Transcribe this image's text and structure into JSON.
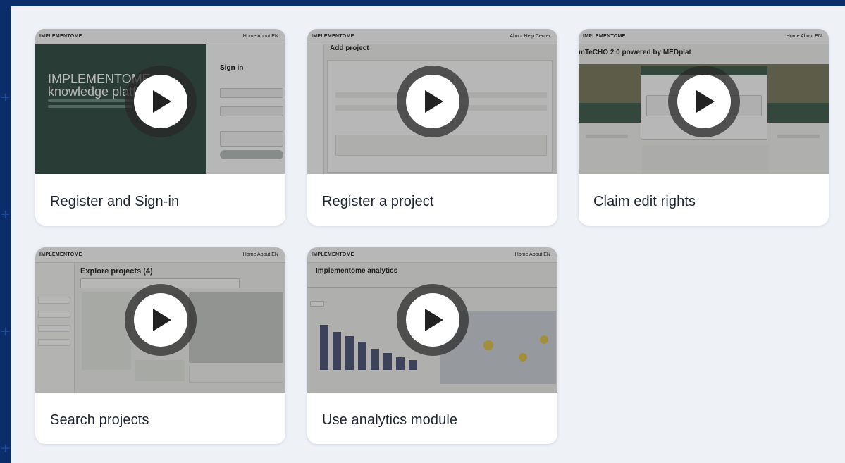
{
  "cards": [
    {
      "title": "Register and Sign-in",
      "hero": "IMPLEMENTOME knowledge platform",
      "side_title": "Sign in",
      "brand": "IMPLEMENTOME",
      "nav": "Home  About  EN"
    },
    {
      "title": "Register a project",
      "hero": "Add project",
      "brand": "IMPLEMENTOME",
      "nav": "About  Help Center"
    },
    {
      "title": "Claim edit rights",
      "hero": "mTeCHO 2.0 powered by MEDplat",
      "brand": "IMPLEMENTOME",
      "nav": "Home  About  EN"
    },
    {
      "title": "Search projects",
      "hero": "Explore projects (4)",
      "brand": "IMPLEMENTOME",
      "nav": "Home  About  EN"
    },
    {
      "title": "Use analytics module",
      "hero": "Implementome analytics",
      "brand": "IMPLEMENTOME",
      "nav": "Home  About  EN"
    }
  ],
  "icons": {
    "play": "play-icon",
    "decor": "plus-icon"
  },
  "colors": {
    "background": "#0c2d6b",
    "panel": "#eef1f6",
    "card": "#ffffff",
    "title": "#1e2430"
  }
}
